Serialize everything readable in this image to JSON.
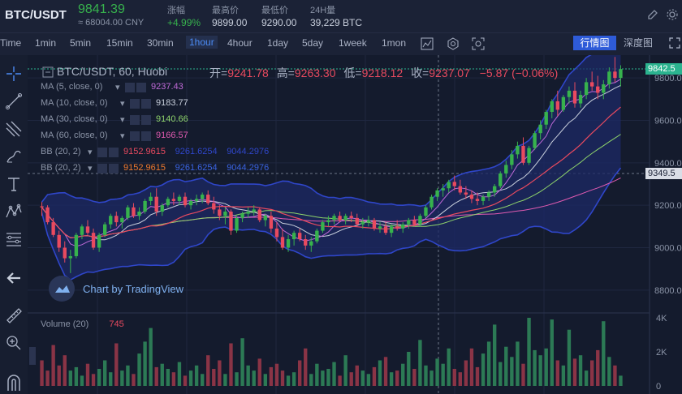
{
  "header": {
    "pair": "BTC/USDT",
    "price": "9841.39",
    "cny": "≈ 68004.00 CNY",
    "stats": [
      {
        "label": "涨幅",
        "value": "+4.99%",
        "up": true
      },
      {
        "label": "最高价",
        "value": "9899.00",
        "up": false
      },
      {
        "label": "最低价",
        "value": "9290.00",
        "up": false
      },
      {
        "label": "24H量",
        "value": "39,229 BTC",
        "up": false
      }
    ]
  },
  "toolbar": {
    "intervals": [
      "Time",
      "1min",
      "5min",
      "15min",
      "30min",
      "1hour",
      "4hour",
      "1day",
      "5day",
      "1week",
      "1mon"
    ],
    "active_interval": "1hour",
    "market_button": "行情图",
    "depth_button": "深度图"
  },
  "legend": {
    "title": "BTC/USDT, 60, Huobi",
    "open_label": "开=",
    "open": "9241.78",
    "high_label": "高=",
    "high": "9263.30",
    "low_label": "低=",
    "low": "9218.12",
    "close_label": "收=",
    "close": "9237.07",
    "change": "−5.87 (−0.06%)"
  },
  "indicators": [
    {
      "label": "MA (5, close, 0)",
      "values": [
        "9237.43"
      ],
      "colors": [
        "#c06ad8"
      ]
    },
    {
      "label": "MA (10, close, 0)",
      "values": [
        "9183.77"
      ],
      "colors": [
        "#c8cfdc"
      ]
    },
    {
      "label": "MA (30, close, 0)",
      "values": [
        "9140.66"
      ],
      "colors": [
        "#8fd46b"
      ]
    },
    {
      "label": "MA (60, close, 0)",
      "values": [
        "9166.57"
      ],
      "colors": [
        "#e05ab0"
      ]
    },
    {
      "label": "BB (20, 2)",
      "values": [
        "9152.9615",
        "9261.6254",
        "9044.2976"
      ],
      "colors": [
        "#e84a5f",
        "#2f46c9",
        "#2f46c9"
      ]
    },
    {
      "label": "BB (20, 2)",
      "values": [
        "9152.9615",
        "9261.6254",
        "9044.2976"
      ],
      "colors": [
        "#f07a2e",
        "#3a63e0",
        "#3a63e0"
      ]
    }
  ],
  "watermark": "Chart by TradingView",
  "volume": {
    "label": "Volume (20)",
    "value": "745"
  },
  "price_axis": [
    "9800.0",
    "9600.0",
    "9400.0",
    "9200.0",
    "9000.0",
    "8800.0"
  ],
  "price_tags": [
    {
      "value": "9842.5",
      "bg": "#2bb38f",
      "fg": "#ffffff"
    },
    {
      "value": "9349.5",
      "bg": "#d9dde6",
      "fg": "#1b2236"
    }
  ],
  "volume_axis": [
    "4K",
    "2K",
    "0"
  ],
  "colors": {
    "up": "#37b24d",
    "down": "#e84a5f",
    "accent": "#2e5bd8"
  },
  "chart_data": {
    "type": "candlestick",
    "series": [
      {
        "name": "BTC/USDT",
        "ohlc": [
          [
            9195,
            9215,
            9150,
            9190
          ],
          [
            9190,
            9200,
            9110,
            9120
          ],
          [
            9120,
            9140,
            9050,
            9060
          ],
          [
            9060,
            9080,
            8980,
            9000
          ],
          [
            9000,
            9030,
            8930,
            8950
          ],
          [
            8950,
            8990,
            8880,
            8960
          ],
          [
            8960,
            9070,
            8950,
            9060
          ],
          [
            9060,
            9110,
            9040,
            9100
          ],
          [
            9100,
            9130,
            9060,
            9070
          ],
          [
            9070,
            9090,
            8990,
            9000
          ],
          [
            9000,
            9070,
            8980,
            9060
          ],
          [
            9060,
            9120,
            9050,
            9110
          ],
          [
            9110,
            9160,
            9090,
            9150
          ],
          [
            9150,
            9170,
            9100,
            9120
          ],
          [
            9120,
            9150,
            9090,
            9140
          ],
          [
            9140,
            9200,
            9130,
            9190
          ],
          [
            9190,
            9210,
            9140,
            9150
          ],
          [
            9150,
            9190,
            9130,
            9170
          ],
          [
            9170,
            9230,
            9160,
            9220
          ],
          [
            9220,
            9260,
            9200,
            9240
          ],
          [
            9240,
            9280,
            9150,
            9170
          ],
          [
            9170,
            9210,
            9150,
            9200
          ],
          [
            9200,
            9240,
            9190,
            9230
          ],
          [
            9230,
            9260,
            9200,
            9220
          ],
          [
            9220,
            9250,
            9200,
            9240
          ],
          [
            9240,
            9260,
            9190,
            9200
          ],
          [
            9200,
            9230,
            9180,
            9220
          ],
          [
            9220,
            9250,
            9200,
            9230
          ],
          [
            9230,
            9260,
            9210,
            9250
          ],
          [
            9250,
            9270,
            9200,
            9210
          ],
          [
            9210,
            9240,
            9160,
            9180
          ],
          [
            9180,
            9200,
            9130,
            9150
          ],
          [
            9150,
            9190,
            9110,
            9170
          ],
          [
            9170,
            9180,
            9060,
            9080
          ],
          [
            9080,
            9150,
            9070,
            9140
          ],
          [
            9140,
            9170,
            9120,
            9160
          ],
          [
            9160,
            9190,
            9140,
            9170
          ],
          [
            9170,
            9200,
            9150,
            9180
          ],
          [
            9180,
            9190,
            9120,
            9130
          ],
          [
            9130,
            9160,
            9100,
            9150
          ],
          [
            9150,
            9170,
            9070,
            9090
          ],
          [
            9090,
            9120,
            9030,
            9050
          ],
          [
            9050,
            9090,
            8990,
            9000
          ],
          [
            9000,
            9060,
            8980,
            9040
          ],
          [
            9040,
            9080,
            9010,
            9070
          ],
          [
            9070,
            9090,
            9030,
            9040
          ],
          [
            9040,
            9060,
            8990,
            9010
          ],
          [
            9010,
            9050,
            8980,
            9030
          ],
          [
            9030,
            9090,
            9020,
            9080
          ],
          [
            9080,
            9130,
            9070,
            9120
          ],
          [
            9120,
            9150,
            9100,
            9130
          ],
          [
            9130,
            9160,
            9110,
            9150
          ],
          [
            9150,
            9170,
            9120,
            9130
          ],
          [
            9130,
            9160,
            9110,
            9150
          ],
          [
            9150,
            9170,
            9120,
            9140
          ],
          [
            9140,
            9160,
            9100,
            9110
          ],
          [
            9110,
            9140,
            9090,
            9120
          ],
          [
            9120,
            9150,
            9100,
            9130
          ],
          [
            9130,
            9140,
            9080,
            9090
          ],
          [
            9090,
            9120,
            9070,
            9100
          ],
          [
            9100,
            9120,
            9060,
            9070
          ],
          [
            9070,
            9110,
            9050,
            9100
          ],
          [
            9100,
            9130,
            9080,
            9090
          ],
          [
            9090,
            9120,
            9070,
            9110
          ],
          [
            9110,
            9140,
            9090,
            9130
          ],
          [
            9130,
            9150,
            9100,
            9110
          ],
          [
            9110,
            9160,
            9100,
            9150
          ],
          [
            9150,
            9200,
            9140,
            9190
          ],
          [
            9190,
            9250,
            9180,
            9240
          ],
          [
            9240,
            9280,
            9220,
            9270
          ],
          [
            9270,
            9300,
            9240,
            9280
          ],
          [
            9280,
            9320,
            9260,
            9310
          ],
          [
            9310,
            9340,
            9270,
            9290
          ],
          [
            9290,
            9320,
            9250,
            9260
          ],
          [
            9260,
            9290,
            9230,
            9250
          ],
          [
            9250,
            9270,
            9210,
            9230
          ],
          [
            9230,
            9260,
            9200,
            9220
          ],
          [
            9220,
            9250,
            9200,
            9240
          ],
          [
            9240,
            9270,
            9220,
            9260
          ],
          [
            9260,
            9300,
            9240,
            9290
          ],
          [
            9290,
            9360,
            9280,
            9350
          ],
          [
            9350,
            9410,
            9330,
            9390
          ],
          [
            9390,
            9460,
            9370,
            9440
          ],
          [
            9440,
            9500,
            9420,
            9480
          ],
          [
            9480,
            9520,
            9390,
            9400
          ],
          [
            9400,
            9480,
            9390,
            9470
          ],
          [
            9470,
            9550,
            9460,
            9540
          ],
          [
            9540,
            9600,
            9510,
            9580
          ],
          [
            9580,
            9650,
            9560,
            9640
          ],
          [
            9640,
            9700,
            9610,
            9690
          ],
          [
            9690,
            9740,
            9620,
            9650
          ],
          [
            9650,
            9720,
            9640,
            9710
          ],
          [
            9710,
            9760,
            9680,
            9740
          ],
          [
            9740,
            9780,
            9660,
            9680
          ],
          [
            9680,
            9740,
            9660,
            9720
          ],
          [
            9720,
            9800,
            9700,
            9780
          ],
          [
            9780,
            9830,
            9740,
            9760
          ],
          [
            9760,
            9810,
            9700,
            9730
          ],
          [
            9730,
            9790,
            9700,
            9770
          ],
          [
            9770,
            9850,
            9750,
            9830
          ],
          [
            9830,
            9899,
            9780,
            9800
          ],
          [
            9800,
            9860,
            9760,
            9842
          ]
        ]
      },
      {
        "name": "Volume",
        "values": [
          1500,
          900,
          2400,
          1200,
          1800,
          900,
          1100,
          600,
          1300,
          700,
          1000,
          1500,
          800,
          2500,
          900,
          1200,
          700,
          1900,
          2600,
          3400,
          1100,
          1300,
          1000,
          800,
          1400,
          600,
          900,
          1200,
          700,
          1800,
          1000,
          1500,
          700,
          2500,
          800,
          2800,
          1200,
          900,
          1600,
          700,
          1100,
          1300,
          900,
          600,
          800,
          1500,
          2200,
          700,
          1300,
          900,
          1000,
          1400,
          600,
          1800,
          800,
          1200,
          900,
          700,
          1100,
          1500,
          1700,
          800,
          900,
          1300,
          2000,
          1000,
          2700,
          1200,
          900,
          1600,
          1300,
          2200,
          1000,
          800,
          1500,
          2200,
          1100,
          1900,
          2600,
          3600,
          1400,
          2300,
          1700,
          2600,
          1300,
          4000,
          2100,
          1800,
          2200,
          3900,
          1500,
          1200,
          3300,
          1600,
          1800,
          900,
          1500,
          2100,
          3800,
          1700,
          1200,
          600
        ]
      }
    ],
    "y_range": [
      8700,
      9900
    ],
    "volume_range": [
      0,
      4000
    ]
  }
}
